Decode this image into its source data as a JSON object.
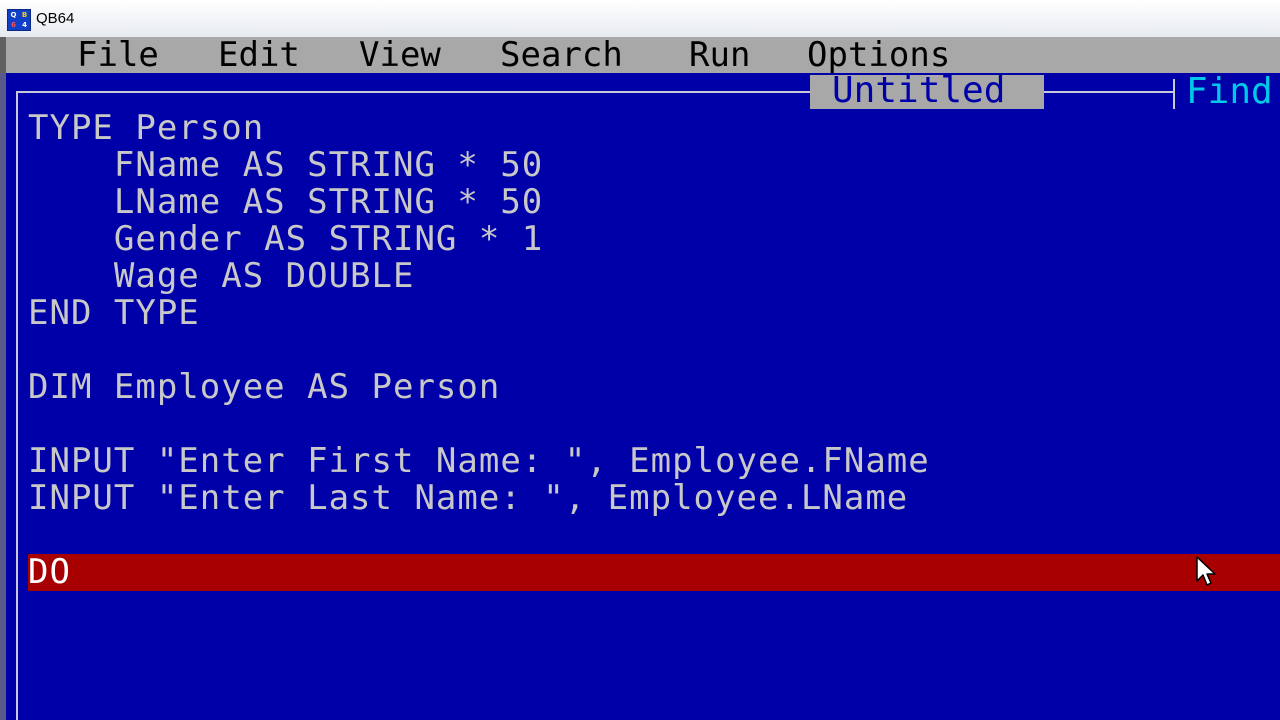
{
  "window": {
    "title": "QB64",
    "icon_text": [
      "Q",
      "B",
      "6",
      "4"
    ]
  },
  "menu": {
    "items": [
      {
        "label": "File"
      },
      {
        "label": "Edit"
      },
      {
        "label": "View"
      },
      {
        "label": "Search"
      },
      {
        "label": "Run"
      },
      {
        "label": "Options"
      }
    ]
  },
  "editor": {
    "document_title": "Untitled",
    "find_label": "Find",
    "lines": [
      "TYPE Person",
      "    FName AS STRING * 50",
      "    LName AS STRING * 50",
      "    Gender AS STRING * 1",
      "    Wage AS DOUBLE",
      "END TYPE",
      "",
      "DIM Employee AS Person",
      "",
      "INPUT \"Enter First Name: \", Employee.FName",
      "INPUT \"Enter Last Name: \", Employee.LName",
      "",
      "DO"
    ],
    "highlighted_line_index": 12,
    "colors": {
      "background": "#0000A8",
      "text": "#C8C8C8",
      "highlight": "#A80000",
      "menu_bar": "#A8A8A8",
      "find_text": "#00C8E8"
    }
  },
  "cursor_icon": "mouse-pointer-icon"
}
